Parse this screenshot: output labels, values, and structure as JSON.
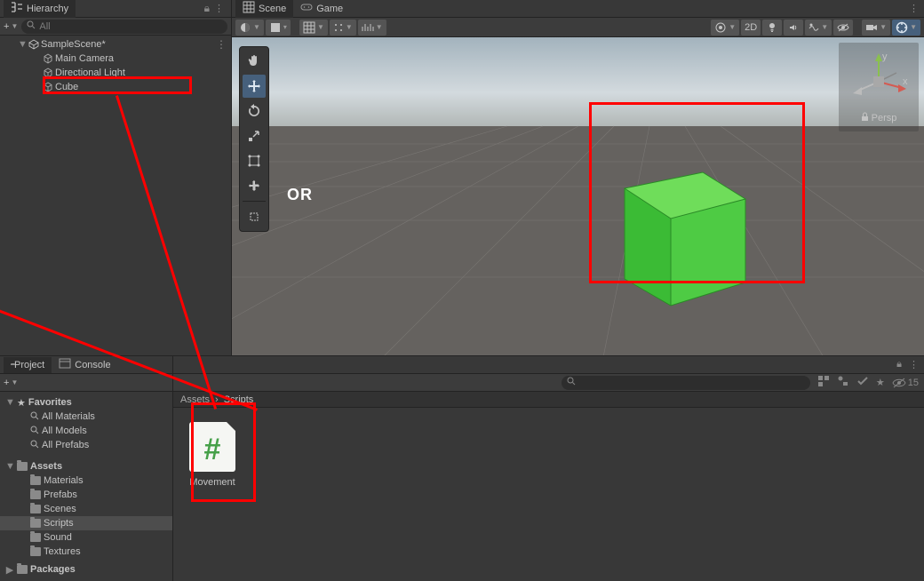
{
  "hierarchy": {
    "tab": "Hierarchy",
    "search_placeholder": "All",
    "scene": "SampleScene*",
    "items": [
      "Main Camera",
      "Directional Light",
      "Cube"
    ]
  },
  "scene": {
    "tabs": [
      "Scene",
      "Game"
    ],
    "btn_2d": "2D",
    "annot_or": "OR",
    "gizmo_persp": "Persp",
    "axis_x": "x",
    "axis_y": "y"
  },
  "project": {
    "tabs": [
      "Project",
      "Console"
    ],
    "slider_value": "15",
    "breadcrumb": [
      "Assets",
      "Scripts"
    ],
    "favorites_label": "Favorites",
    "favorites": [
      "All Materials",
      "All Models",
      "All Prefabs"
    ],
    "assets_label": "Assets",
    "assets_folders": [
      "Materials",
      "Prefabs",
      "Scenes",
      "Scripts",
      "Sound",
      "Textures"
    ],
    "packages_label": "Packages",
    "selected_folder_index": 3,
    "file": {
      "name": "Movement"
    }
  }
}
